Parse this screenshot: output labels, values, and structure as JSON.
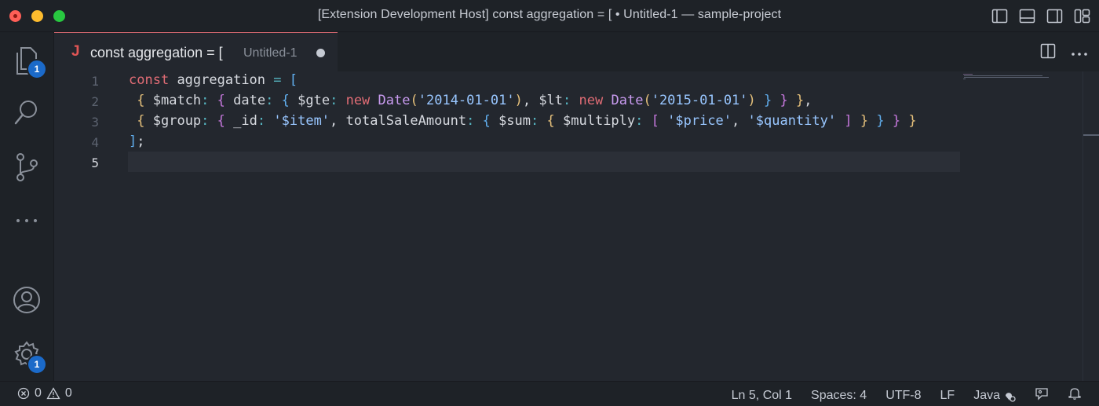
{
  "window": {
    "title": "[Extension Development Host] const aggregation = [ • Untitled-1 — sample-project"
  },
  "activity_bar": {
    "explorer_badge": "1",
    "settings_badge": "1"
  },
  "tab": {
    "language_icon": "J",
    "title": "const aggregation = [",
    "description": "Untitled-1",
    "dirty": true
  },
  "editor": {
    "line_numbers": [
      "1",
      "2",
      "3",
      "4",
      "5"
    ],
    "active_line": "5",
    "lines": [
      "const aggregation = [",
      " { $match: { date: { $gte: new Date('2014-01-01'), $lt: new Date('2015-01-01') } } },",
      " { $group: { _id: '$item', totalSaleAmount: { $sum: { $multiply: [ '$price', '$quantity' ] } } } }",
      "];",
      ""
    ]
  },
  "status_bar": {
    "errors": "0",
    "warnings": "0",
    "position": "Ln 5, Col 1",
    "spaces": "Spaces: 4",
    "encoding": "UTF-8",
    "eol": "LF",
    "language": "Java"
  }
}
